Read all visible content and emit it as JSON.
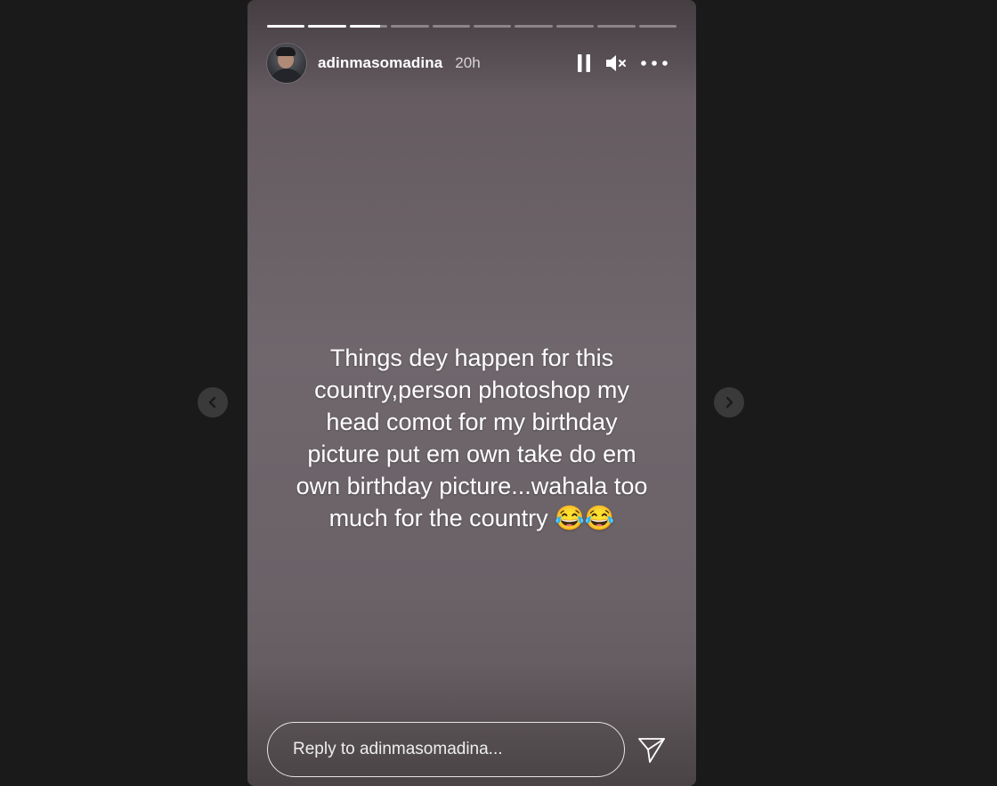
{
  "story": {
    "progress": {
      "segments": [
        1,
        1,
        0.8,
        0,
        0,
        0,
        0,
        0,
        0,
        0
      ]
    },
    "header": {
      "avatar_icon": "profile-avatar",
      "username": "adinmasomadina",
      "timestamp": "20h",
      "controls": [
        "pause-icon",
        "mute-icon",
        "more-options-icon"
      ]
    },
    "caption": "Things dey happen for this\ncountry,person photoshop my\nhead comot for my birthday\npicture put em own take do em\nown birthday picture...wahala too\nmuch for the country 😂😂",
    "reply": {
      "placeholder": "Reply to adinmasomadina...",
      "send_icon": "send-icon"
    }
  },
  "navigation": {
    "prev_icon": "chevron-left-icon",
    "next_icon": "chevron-right-icon"
  },
  "colors": {
    "page_background": "#1a1a1a",
    "story_background": "#6f676c",
    "text": "#ffffff"
  }
}
